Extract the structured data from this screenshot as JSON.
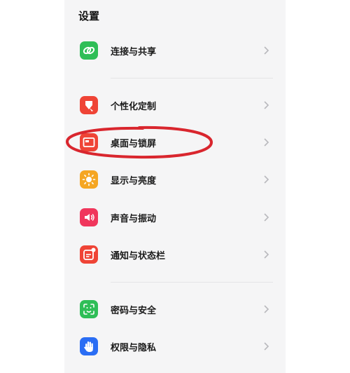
{
  "header": {
    "title": "设置"
  },
  "items": [
    {
      "label": "连接与共享",
      "icon": "link-share-icon",
      "color": "#2fbe57"
    },
    {
      "label": "个性化定制",
      "icon": "paint-brush-icon",
      "color": "#ef4436"
    },
    {
      "label": "桌面与锁屏",
      "icon": "desktop-lock-icon",
      "color": "#ef4436"
    },
    {
      "label": "显示与亮度",
      "icon": "sun-icon",
      "color": "#f5a623"
    },
    {
      "label": "声音与振动",
      "icon": "speaker-icon",
      "color": "#f0365c"
    },
    {
      "label": "通知与状态栏",
      "icon": "notification-icon",
      "color": "#ef4436"
    },
    {
      "label": "密码与安全",
      "icon": "face-id-icon",
      "color": "#2fbe57"
    },
    {
      "label": "权限与隐私",
      "icon": "hand-icon",
      "color": "#2a6df4"
    }
  ],
  "annotation": {
    "color": "#d9262e"
  }
}
